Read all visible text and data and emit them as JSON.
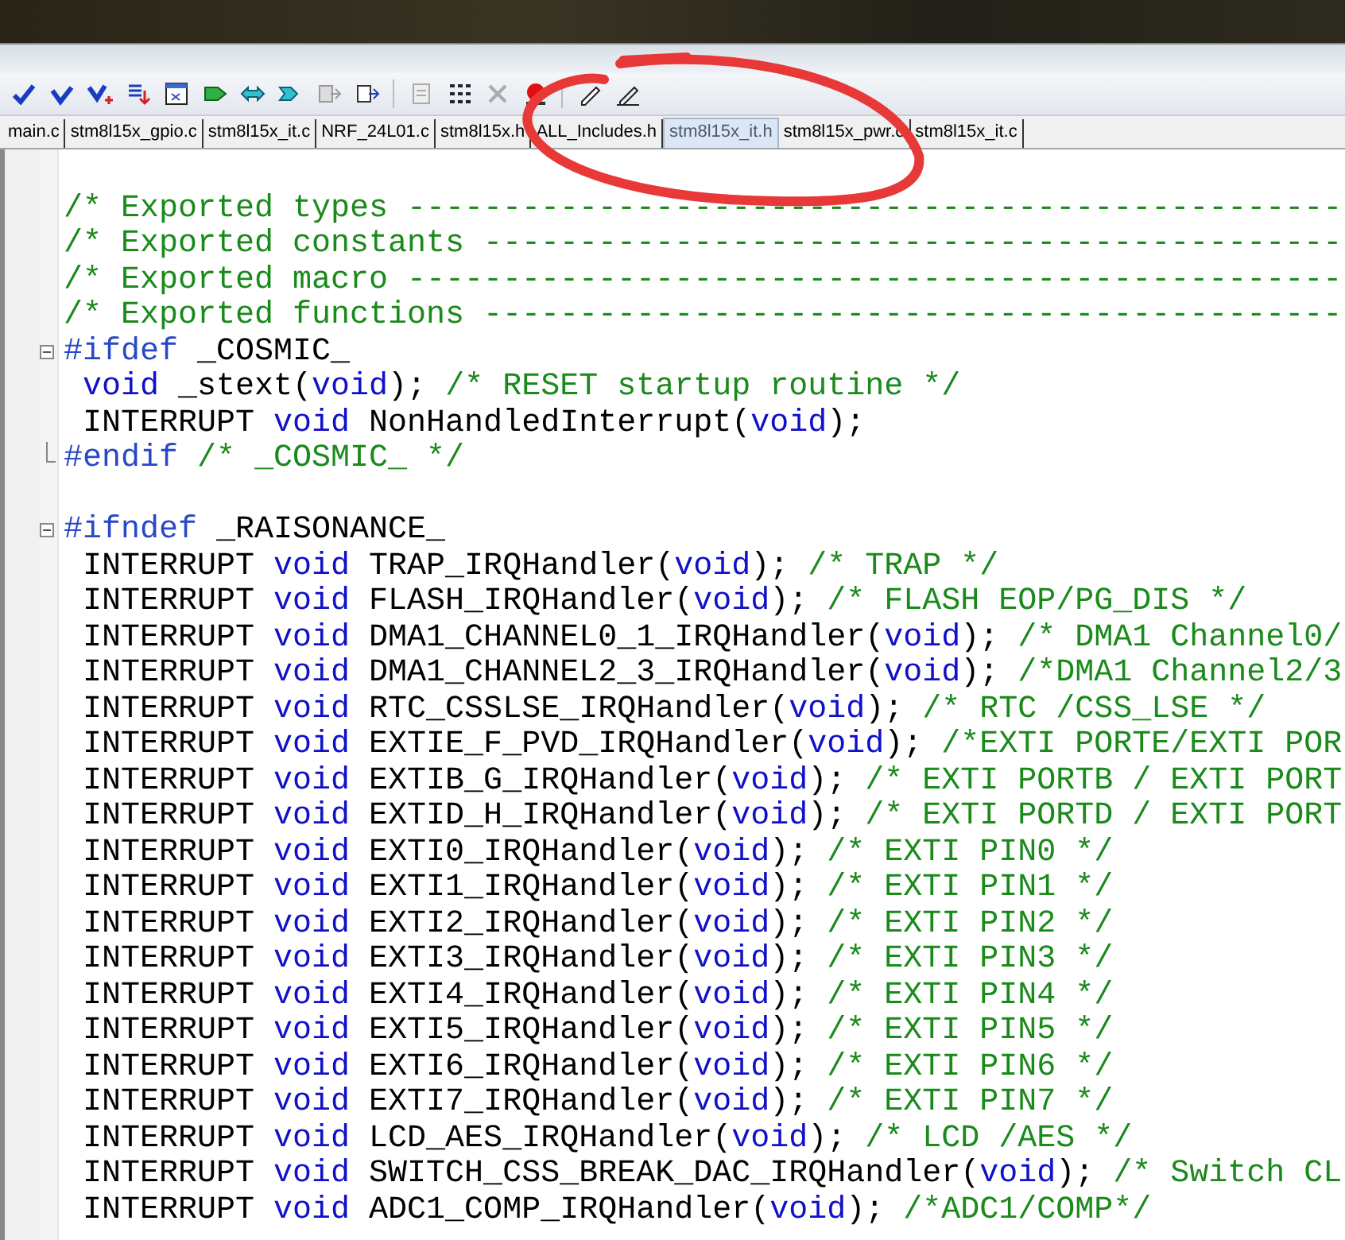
{
  "tabs": [
    {
      "label": "main.c",
      "selected": false
    },
    {
      "label": "stm8l15x_gpio.c",
      "selected": false
    },
    {
      "label": "stm8l15x_it.c",
      "selected": false
    },
    {
      "label": "NRF_24L01.c",
      "selected": false
    },
    {
      "label": "stm8l15x.h",
      "selected": false
    },
    {
      "label": "ALL_Includes.h",
      "selected": false
    },
    {
      "label": "stm8l15x_it.h",
      "selected": true
    },
    {
      "label": "stm8l15x_pwr.c",
      "selected": false
    },
    {
      "label": "stm8l15x_it.c",
      "selected": false
    }
  ],
  "editor": {
    "sections": [
      {
        "lines": [
          {
            "segments": [
              {
                "kind": "comment",
                "text": "/* Exported types -------------------------------------------------"
              }
            ]
          },
          {
            "segments": [
              {
                "kind": "comment",
                "text": "/* Exported constants ---------------------------------------------"
              }
            ]
          },
          {
            "segments": [
              {
                "kind": "comment",
                "text": "/* Exported macro -------------------------------------------------"
              }
            ]
          },
          {
            "segments": [
              {
                "kind": "comment",
                "text": "/* Exported functions ---------------------------------------------"
              }
            ]
          },
          {
            "fold_start": true,
            "segments": [
              {
                "kind": "preproc",
                "text": "#ifdef"
              },
              {
                "kind": "plain",
                "text": " _COSMIC_"
              }
            ]
          },
          {
            "segments": [
              {
                "kind": "keyword",
                "text": " void"
              },
              {
                "kind": "plain",
                "text": " _stext("
              },
              {
                "kind": "keyword",
                "text": "void"
              },
              {
                "kind": "plain",
                "text": "); "
              },
              {
                "kind": "comment",
                "text": "/* RESET startup routine */"
              }
            ]
          },
          {
            "segments": [
              {
                "kind": "plain",
                "text": " INTERRUPT "
              },
              {
                "kind": "keyword",
                "text": "void"
              },
              {
                "kind": "plain",
                "text": " NonHandledInterrupt("
              },
              {
                "kind": "keyword",
                "text": "void"
              },
              {
                "kind": "plain",
                "text": ");"
              }
            ]
          },
          {
            "fold_end": true,
            "segments": [
              {
                "kind": "preproc",
                "text": "#endif"
              },
              {
                "kind": "comment",
                "text": " /* _COSMIC_ */"
              }
            ]
          }
        ]
      },
      {
        "lines": [
          {
            "fold_start": true,
            "segments": [
              {
                "kind": "preproc",
                "text": "#ifndef"
              },
              {
                "kind": "plain",
                "text": " _RAISONANCE_"
              }
            ]
          },
          {
            "segments": [
              {
                "kind": "plain",
                "text": " INTERRUPT "
              },
              {
                "kind": "keyword",
                "text": "void"
              },
              {
                "kind": "plain",
                "text": " TRAP_IRQHandler("
              },
              {
                "kind": "keyword",
                "text": "void"
              },
              {
                "kind": "plain",
                "text": "); "
              },
              {
                "kind": "comment",
                "text": "/* TRAP */"
              }
            ]
          },
          {
            "segments": [
              {
                "kind": "plain",
                "text": " INTERRUPT "
              },
              {
                "kind": "keyword",
                "text": "void"
              },
              {
                "kind": "plain",
                "text": " FLASH_IRQHandler("
              },
              {
                "kind": "keyword",
                "text": "void"
              },
              {
                "kind": "plain",
                "text": "); "
              },
              {
                "kind": "comment",
                "text": "/* FLASH EOP/PG_DIS */"
              }
            ]
          },
          {
            "segments": [
              {
                "kind": "plain",
                "text": " INTERRUPT "
              },
              {
                "kind": "keyword",
                "text": "void"
              },
              {
                "kind": "plain",
                "text": " DMA1_CHANNEL0_1_IRQHandler("
              },
              {
                "kind": "keyword",
                "text": "void"
              },
              {
                "kind": "plain",
                "text": "); "
              },
              {
                "kind": "comment",
                "text": "/* DMA1 Channel0/"
              }
            ]
          },
          {
            "segments": [
              {
                "kind": "plain",
                "text": " INTERRUPT "
              },
              {
                "kind": "keyword",
                "text": "void"
              },
              {
                "kind": "plain",
                "text": " DMA1_CHANNEL2_3_IRQHandler("
              },
              {
                "kind": "keyword",
                "text": "void"
              },
              {
                "kind": "plain",
                "text": "); "
              },
              {
                "kind": "comment",
                "text": "/*DMA1 Channel2/3"
              }
            ]
          },
          {
            "segments": [
              {
                "kind": "plain",
                "text": " INTERRUPT "
              },
              {
                "kind": "keyword",
                "text": "void"
              },
              {
                "kind": "plain",
                "text": " RTC_CSSLSE_IRQHandler("
              },
              {
                "kind": "keyword",
                "text": "void"
              },
              {
                "kind": "plain",
                "text": "); "
              },
              {
                "kind": "comment",
                "text": "/* RTC /CSS_LSE */"
              }
            ]
          },
          {
            "segments": [
              {
                "kind": "plain",
                "text": " INTERRUPT "
              },
              {
                "kind": "keyword",
                "text": "void"
              },
              {
                "kind": "plain",
                "text": " EXTIE_F_PVD_IRQHandler("
              },
              {
                "kind": "keyword",
                "text": "void"
              },
              {
                "kind": "plain",
                "text": "); "
              },
              {
                "kind": "comment",
                "text": "/*EXTI PORTE/EXTI POR"
              }
            ]
          },
          {
            "segments": [
              {
                "kind": "plain",
                "text": " INTERRUPT "
              },
              {
                "kind": "keyword",
                "text": "void"
              },
              {
                "kind": "plain",
                "text": " EXTIB_G_IRQHandler("
              },
              {
                "kind": "keyword",
                "text": "void"
              },
              {
                "kind": "plain",
                "text": "); "
              },
              {
                "kind": "comment",
                "text": "/* EXTI PORTB / EXTI PORT"
              }
            ]
          },
          {
            "segments": [
              {
                "kind": "plain",
                "text": " INTERRUPT "
              },
              {
                "kind": "keyword",
                "text": "void"
              },
              {
                "kind": "plain",
                "text": " EXTID_H_IRQHandler("
              },
              {
                "kind": "keyword",
                "text": "void"
              },
              {
                "kind": "plain",
                "text": "); "
              },
              {
                "kind": "comment",
                "text": "/* EXTI PORTD / EXTI PORT"
              }
            ]
          },
          {
            "segments": [
              {
                "kind": "plain",
                "text": " INTERRUPT "
              },
              {
                "kind": "keyword",
                "text": "void"
              },
              {
                "kind": "plain",
                "text": " EXTI0_IRQHandler("
              },
              {
                "kind": "keyword",
                "text": "void"
              },
              {
                "kind": "plain",
                "text": "); "
              },
              {
                "kind": "comment",
                "text": "/* EXTI PIN0 */"
              }
            ]
          },
          {
            "segments": [
              {
                "kind": "plain",
                "text": " INTERRUPT "
              },
              {
                "kind": "keyword",
                "text": "void"
              },
              {
                "kind": "plain",
                "text": " EXTI1_IRQHandler("
              },
              {
                "kind": "keyword",
                "text": "void"
              },
              {
                "kind": "plain",
                "text": "); "
              },
              {
                "kind": "comment",
                "text": "/* EXTI PIN1 */"
              }
            ]
          },
          {
            "segments": [
              {
                "kind": "plain",
                "text": " INTERRUPT "
              },
              {
                "kind": "keyword",
                "text": "void"
              },
              {
                "kind": "plain",
                "text": " EXTI2_IRQHandler("
              },
              {
                "kind": "keyword",
                "text": "void"
              },
              {
                "kind": "plain",
                "text": "); "
              },
              {
                "kind": "comment",
                "text": "/* EXTI PIN2 */"
              }
            ]
          },
          {
            "segments": [
              {
                "kind": "plain",
                "text": " INTERRUPT "
              },
              {
                "kind": "keyword",
                "text": "void"
              },
              {
                "kind": "plain",
                "text": " EXTI3_IRQHandler("
              },
              {
                "kind": "keyword",
                "text": "void"
              },
              {
                "kind": "plain",
                "text": "); "
              },
              {
                "kind": "comment",
                "text": "/* EXTI PIN3 */"
              }
            ]
          },
          {
            "segments": [
              {
                "kind": "plain",
                "text": " INTERRUPT "
              },
              {
                "kind": "keyword",
                "text": "void"
              },
              {
                "kind": "plain",
                "text": " EXTI4_IRQHandler("
              },
              {
                "kind": "keyword",
                "text": "void"
              },
              {
                "kind": "plain",
                "text": "); "
              },
              {
                "kind": "comment",
                "text": "/* EXTI PIN4 */"
              }
            ]
          },
          {
            "segments": [
              {
                "kind": "plain",
                "text": " INTERRUPT "
              },
              {
                "kind": "keyword",
                "text": "void"
              },
              {
                "kind": "plain",
                "text": " EXTI5_IRQHandler("
              },
              {
                "kind": "keyword",
                "text": "void"
              },
              {
                "kind": "plain",
                "text": "); "
              },
              {
                "kind": "comment",
                "text": "/* EXTI PIN5 */"
              }
            ]
          },
          {
            "segments": [
              {
                "kind": "plain",
                "text": " INTERRUPT "
              },
              {
                "kind": "keyword",
                "text": "void"
              },
              {
                "kind": "plain",
                "text": " EXTI6_IRQHandler("
              },
              {
                "kind": "keyword",
                "text": "void"
              },
              {
                "kind": "plain",
                "text": "); "
              },
              {
                "kind": "comment",
                "text": "/* EXTI PIN6 */"
              }
            ]
          },
          {
            "segments": [
              {
                "kind": "plain",
                "text": " INTERRUPT "
              },
              {
                "kind": "keyword",
                "text": "void"
              },
              {
                "kind": "plain",
                "text": " EXTI7_IRQHandler("
              },
              {
                "kind": "keyword",
                "text": "void"
              },
              {
                "kind": "plain",
                "text": "); "
              },
              {
                "kind": "comment",
                "text": "/* EXTI PIN7 */"
              }
            ]
          },
          {
            "segments": [
              {
                "kind": "plain",
                "text": " INTERRUPT "
              },
              {
                "kind": "keyword",
                "text": "void"
              },
              {
                "kind": "plain",
                "text": " LCD_AES_IRQHandler("
              },
              {
                "kind": "keyword",
                "text": "void"
              },
              {
                "kind": "plain",
                "text": "); "
              },
              {
                "kind": "comment",
                "text": "/* LCD /AES */"
              }
            ]
          },
          {
            "segments": [
              {
                "kind": "plain",
                "text": " INTERRUPT "
              },
              {
                "kind": "keyword",
                "text": "void"
              },
              {
                "kind": "plain",
                "text": " SWITCH_CSS_BREAK_DAC_IRQHandler("
              },
              {
                "kind": "keyword",
                "text": "void"
              },
              {
                "kind": "plain",
                "text": "); "
              },
              {
                "kind": "comment",
                "text": "/* Switch CL"
              }
            ]
          },
          {
            "segments": [
              {
                "kind": "plain",
                "text": " INTERRUPT "
              },
              {
                "kind": "keyword",
                "text": "void"
              },
              {
                "kind": "plain",
                "text": " ADC1_COMP_IRQHandler("
              },
              {
                "kind": "keyword",
                "text": "void"
              },
              {
                "kind": "plain",
                "text": "); "
              },
              {
                "kind": "comment",
                "text": "/*ADC1/COMP*/"
              }
            ]
          }
        ]
      }
    ]
  }
}
